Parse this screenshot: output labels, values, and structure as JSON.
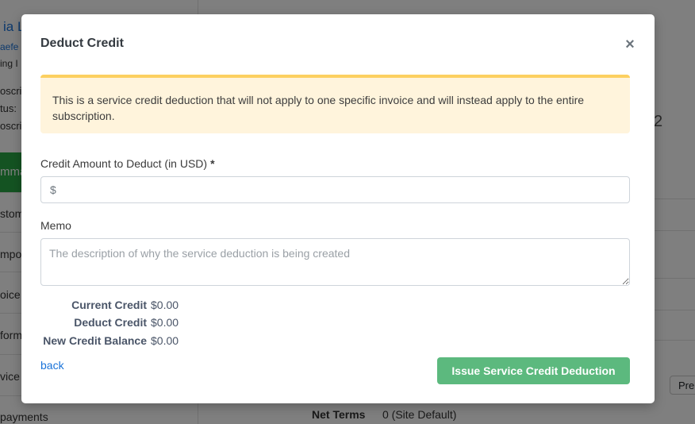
{
  "background": {
    "customer_name": "ia L",
    "customer_sub": "aefe",
    "sidebar_fragments": [
      "ing I",
      "oscri",
      "tus:",
      "oscri"
    ],
    "green_tab": "mma",
    "sidebar_items": [
      "stom",
      "mpo",
      "oice",
      "form",
      "vice",
      "payments"
    ],
    "right_number": "2",
    "prev_button": "Pre",
    "net_terms_label": "Net Terms",
    "net_terms_value": "0 (Site Default)"
  },
  "modal": {
    "title": "Deduct Credit",
    "close_label": "×",
    "alert_text": "This is a service credit deduction that will not apply to one specific invoice and will instead apply to the entire subscription.",
    "amount": {
      "label": "Credit Amount to Deduct (in USD)",
      "required_mark": "*",
      "prefix": "$",
      "value": "",
      "placeholder": ""
    },
    "memo": {
      "label": "Memo",
      "value": "",
      "placeholder": "The description of why the service deduction is being created"
    },
    "summary": {
      "current_credit_label": "Current Credit",
      "current_credit_value": "$0.00",
      "deduct_credit_label": "Deduct Credit",
      "deduct_credit_value": "$0.00",
      "new_balance_label": "New Credit Balance",
      "new_balance_value": "$0.00"
    },
    "back_label": "back",
    "submit_label": "Issue Service Credit Deduction"
  },
  "colors": {
    "alert_bg": "#fff4dc",
    "alert_border": "#fcd060",
    "link": "#1a73d9",
    "submit_button": "#5cb97e"
  }
}
